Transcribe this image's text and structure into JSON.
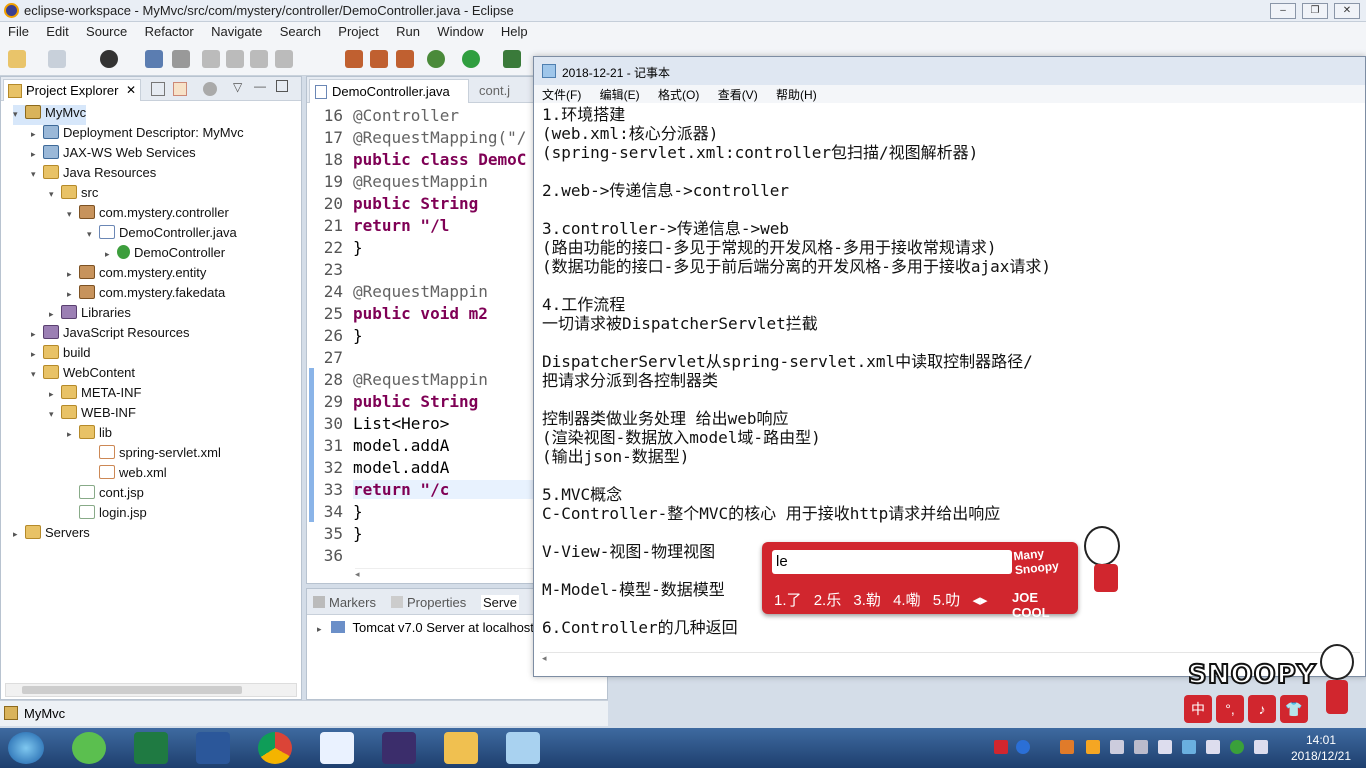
{
  "eclipse": {
    "title": "eclipse-workspace - MyMvc/src/com/mystery/controller/DemoController.java - Eclipse",
    "menu": [
      "File",
      "Edit",
      "Source",
      "Refactor",
      "Navigate",
      "Search",
      "Project",
      "Run",
      "Window",
      "Help"
    ],
    "project_explorer": {
      "tab_label": "Project Explorer",
      "tree": [
        {
          "label": "MyMvc",
          "icon": "project-icon",
          "arrow": "▾",
          "selected": true
        },
        {
          "label": "Deployment Descriptor: MyMvc",
          "icon": "web-icon",
          "arrow": "▸"
        },
        {
          "label": "JAX-WS Web Services",
          "icon": "web-icon",
          "arrow": "▸"
        },
        {
          "label": "Java Resources",
          "icon": "folder-icon",
          "arrow": "▾"
        },
        {
          "label": "src",
          "icon": "folder-icon",
          "arrow": "▾"
        },
        {
          "label": "com.mystery.controller",
          "icon": "package-icon",
          "arrow": "▾"
        },
        {
          "label": "DemoController.java",
          "icon": "java-file-icon",
          "arrow": "▾"
        },
        {
          "label": "DemoController",
          "icon": "class-icon",
          "arrow": "▸"
        },
        {
          "label": "com.mystery.entity",
          "icon": "package-icon",
          "arrow": "▸"
        },
        {
          "label": "com.mystery.fakedata",
          "icon": "package-icon",
          "arrow": "▸"
        },
        {
          "label": "Libraries",
          "icon": "library-icon",
          "arrow": "▸"
        },
        {
          "label": "JavaScript Resources",
          "icon": "library-icon",
          "arrow": "▸"
        },
        {
          "label": "build",
          "icon": "folder-icon",
          "arrow": "▸"
        },
        {
          "label": "WebContent",
          "icon": "folder-icon",
          "arrow": "▾"
        },
        {
          "label": "META-INF",
          "icon": "folder-icon",
          "arrow": "▸"
        },
        {
          "label": "WEB-INF",
          "icon": "folder-icon",
          "arrow": "▾"
        },
        {
          "label": "lib",
          "icon": "folder-icon",
          "arrow": "▸"
        },
        {
          "label": "spring-servlet.xml",
          "icon": "xml-file-icon",
          "arrow": ""
        },
        {
          "label": "web.xml",
          "icon": "xml-file-icon",
          "arrow": ""
        },
        {
          "label": "cont.jsp",
          "icon": "jsp-file-icon",
          "arrow": ""
        },
        {
          "label": "login.jsp",
          "icon": "jsp-file-icon",
          "arrow": ""
        },
        {
          "label": "Servers",
          "icon": "folder-icon",
          "arrow": "▸"
        }
      ]
    },
    "editor": {
      "active_tab": "DemoController.java",
      "other_tab": "cont.j",
      "lines": [
        {
          "n": "16",
          "text": "@Controller"
        },
        {
          "n": "17",
          "text": "@RequestMapping(\"/"
        },
        {
          "n": "18",
          "text": "public class DemoC"
        },
        {
          "n": "19",
          "text": "    @RequestMappin"
        },
        {
          "n": "20",
          "text": "    public String "
        },
        {
          "n": "21",
          "text": "        return \"/l"
        },
        {
          "n": "22",
          "text": "    }"
        },
        {
          "n": "23",
          "text": ""
        },
        {
          "n": "24",
          "text": "    @RequestMappin"
        },
        {
          "n": "25",
          "text": "    public void m2"
        },
        {
          "n": "26",
          "text": "    }"
        },
        {
          "n": "27",
          "text": ""
        },
        {
          "n": "28",
          "text": "    @RequestMappin"
        },
        {
          "n": "29",
          "text": "    public String "
        },
        {
          "n": "30",
          "text": "        List<Hero>"
        },
        {
          "n": "31",
          "text": "        model.addA"
        },
        {
          "n": "32",
          "text": "        model.addA"
        },
        {
          "n": "33",
          "text": "        return \"/c"
        },
        {
          "n": "34",
          "text": "    }"
        },
        {
          "n": "35",
          "text": "}"
        },
        {
          "n": "36",
          "text": ""
        }
      ]
    },
    "bottom_panel": {
      "tabs": [
        "Markers",
        "Properties",
        "Serve"
      ],
      "server_row": "Tomcat v7.0 Server at localhost"
    },
    "status_bar": "MyMvc"
  },
  "notepad": {
    "title": "2018-12-21 - 记事本",
    "menu": [
      "文件(F)",
      "编辑(E)",
      "格式(O)",
      "查看(V)",
      "帮助(H)"
    ],
    "lines": [
      "1.环境搭建",
      "(web.xml:核心分派器)",
      "(spring-servlet.xml:controller包扫描/视图解析器)",
      "",
      "2.web->传递信息->controller",
      "",
      "3.controller->传递信息->web",
      "(路由功能的接口-多见于常规的开发风格-多用于接收常规请求)",
      "(数据功能的接口-多见于前后端分离的开发风格-多用于接收ajax请求)",
      "",
      "4.工作流程",
      "一切请求被DispatcherServlet拦截",
      "",
      "DispatcherServlet从spring-servlet.xml中读取控制器路径/",
      "把请求分派到各控制器类",
      "",
      "控制器类做业务处理 给出web响应",
      "(渲染视图-数据放入model域-路由型)",
      "(输出json-数据型)",
      "",
      "5.MVC概念",
      "C-Controller-整个MVC的核心 用于接收http请求并给出响应",
      "",
      "V-View-视图-物理视图",
      "",
      "M-Model-模型-数据模型",
      "",
      "6.Controller的几种返回"
    ]
  },
  "ime": {
    "input": "le",
    "candidates": [
      "1.了",
      "2.乐",
      "3.勒",
      "4.嘞",
      "5.叻"
    ],
    "brand": "JOE COOL",
    "brand_top": "Many Snoopy"
  },
  "snoopy_widget": {
    "logo": "SNOOPY",
    "keys": [
      "中",
      "°,",
      "♪",
      "👕"
    ]
  },
  "taskbar": {
    "time": "14:01",
    "date": "2018/12/21"
  }
}
